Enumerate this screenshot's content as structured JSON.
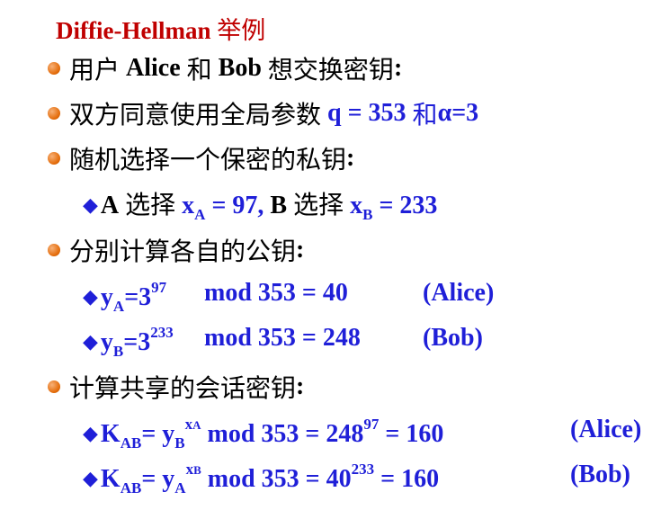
{
  "title": {
    "latin": "Diffie-Hellman",
    "cjk": "举例"
  },
  "bullets": {
    "b1": {
      "pre": "用户",
      "alice": "Alice",
      "and": "和",
      "bob": "Bob",
      "post": "想交换密钥",
      "colon": ":"
    },
    "b2": {
      "pre": "双方同意使用全局参数",
      "q": "q = 353",
      "and": "和",
      "alpha": "α=3"
    },
    "b3": {
      "text": "随机选择一个保密的私钥",
      "colon": ":"
    },
    "b4": {
      "text": "分别计算各自的公钥",
      "colon": ":"
    },
    "b5": {
      "text": "计算共享的会话密钥",
      "colon": ":"
    }
  },
  "private_keys": {
    "a": "A",
    "choose1": "选择",
    "x": "x",
    "sub_a": "A",
    "val_a": "= 97,",
    "b": "B",
    "choose2": "选择",
    "sub_b": "B",
    "val_b": "= 233"
  },
  "public_keys": {
    "ya": {
      "y": "y",
      "sub": "A",
      "base": "=3",
      "exp": "97",
      "rest": "mod 353 = 40",
      "who": "(Alice)"
    },
    "yb": {
      "y": "y",
      "sub": "B",
      "base": "=3",
      "exp": "233",
      "rest": "mod 353 = 248",
      "who": "(Bob)"
    }
  },
  "session_keys": {
    "k1": {
      "k": "K",
      "sub": "AB",
      "eq": "= y",
      "ysub": "B",
      "xexp": "x",
      "xexp_sub": "A",
      "mid": "mod 353 = 248",
      "exp": "97",
      "res": "= 160",
      "who": "(Alice)"
    },
    "k2": {
      "k": "K",
      "sub": "AB",
      "eq": "= y",
      "ysub": "A",
      "xexp": "x",
      "xexp_sub": "B",
      "mid": "mod 353 = 40",
      "exp": "233",
      "res": "= 160",
      "who": "(Bob)"
    }
  },
  "colors": {
    "title": "#c00000",
    "blue": "#1f1fd8",
    "bullet": "#e46c0a"
  }
}
